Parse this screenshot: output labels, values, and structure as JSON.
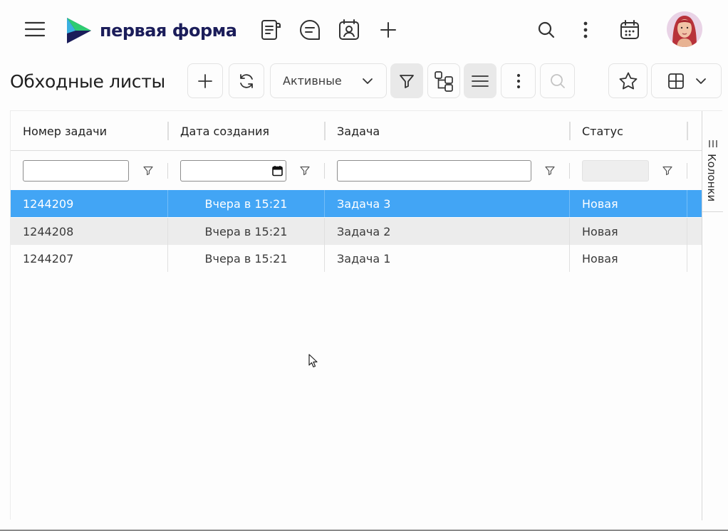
{
  "app": {
    "brand_name": "первая форма",
    "colors": {
      "accent": "#42a5f5",
      "brand_dark": "#1b1d5a",
      "brand_green": "#2ecc71"
    }
  },
  "topbar": {
    "icons": [
      "menu-icon",
      "documents-icon",
      "chat-icon",
      "contacts-icon",
      "add-icon",
      "search-icon",
      "more-vertical-icon",
      "calendar-icon"
    ]
  },
  "toolbar": {
    "title": "Обходные листы",
    "filter_select": {
      "value": "Активные"
    }
  },
  "grid": {
    "columns": [
      "Номер задачи",
      "Дата создания",
      "Задача",
      "Статус"
    ],
    "rows": [
      {
        "id": "1244209",
        "created": "Вчера в 15:21",
        "task": "Задача 3",
        "status": "Новая",
        "selected": true
      },
      {
        "id": "1244208",
        "created": "Вчера в 15:21",
        "task": "Задача 2",
        "status": "Новая",
        "selected": false
      },
      {
        "id": "1244207",
        "created": "Вчера в 15:21",
        "task": "Задача 1",
        "status": "Новая",
        "selected": false
      }
    ],
    "side_tab_label": "Колонки"
  }
}
